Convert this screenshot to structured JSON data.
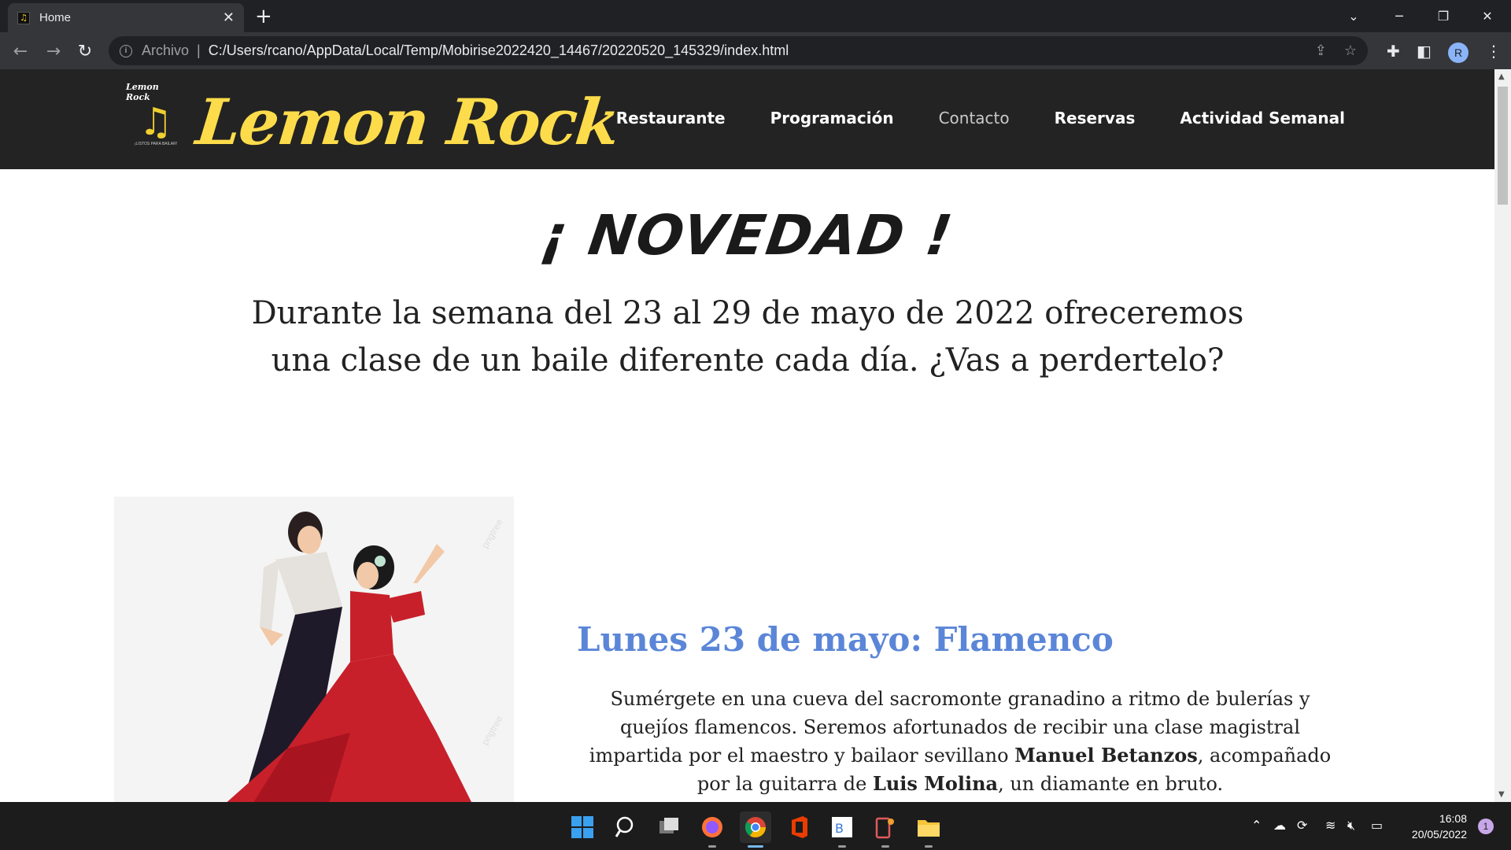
{
  "browser": {
    "tab_title": "Home",
    "tab_favicon": "lemon-rock-favicon",
    "new_tab": "+",
    "address_scheme": "Archivo",
    "address_url": "C:/Users/rcano/AppData/Local/Temp/Mobirise2022420_14467/20220520_145329/index.html",
    "profile_initial": "R"
  },
  "site": {
    "logo_small_text": "Lemon Rock",
    "logo_small_tagline": "¡LISTOS PARA BAILAR!",
    "brand": "Lemon Rock",
    "menu": [
      {
        "label": "Restaurante"
      },
      {
        "label": "Programación"
      },
      {
        "label": "Contacto"
      },
      {
        "label": "Reservas"
      },
      {
        "label": "Actividad Semanal"
      }
    ]
  },
  "main": {
    "heading": "¡ NOVEDAD !",
    "intro": "Durante la semana del 23 al 29 de mayo de 2022 ofreceremos una clase de un baile diferente cada día. ¿Vas a perdertelo?",
    "day_title": "Lunes 23 de mayo: Flamenco",
    "desc_1": "Sumérgete en una cueva del sacromonte granadino a ritmo de bulerías y quejíos flamencos. Seremos afortunados de recibir una clase magistral impartida por el maestro y bailaor sevillano ",
    "desc_name_1": "Manuel Betanzos",
    "desc_2": ", acompañado por la guitarra de ",
    "desc_name_2": "Luis Molina",
    "desc_3": ", un diamante en bruto.",
    "illustration": "flamenco-dancers-illustration",
    "watermark": "pngtree"
  },
  "taskbar": {
    "time": "16:08",
    "date": "20/05/2022",
    "notification_count": "1"
  },
  "colors": {
    "nav_bg": "#232323",
    "brand_yellow": "#fddc4b",
    "title_blue": "#5b86d8",
    "dress_red": "#c8202a"
  }
}
